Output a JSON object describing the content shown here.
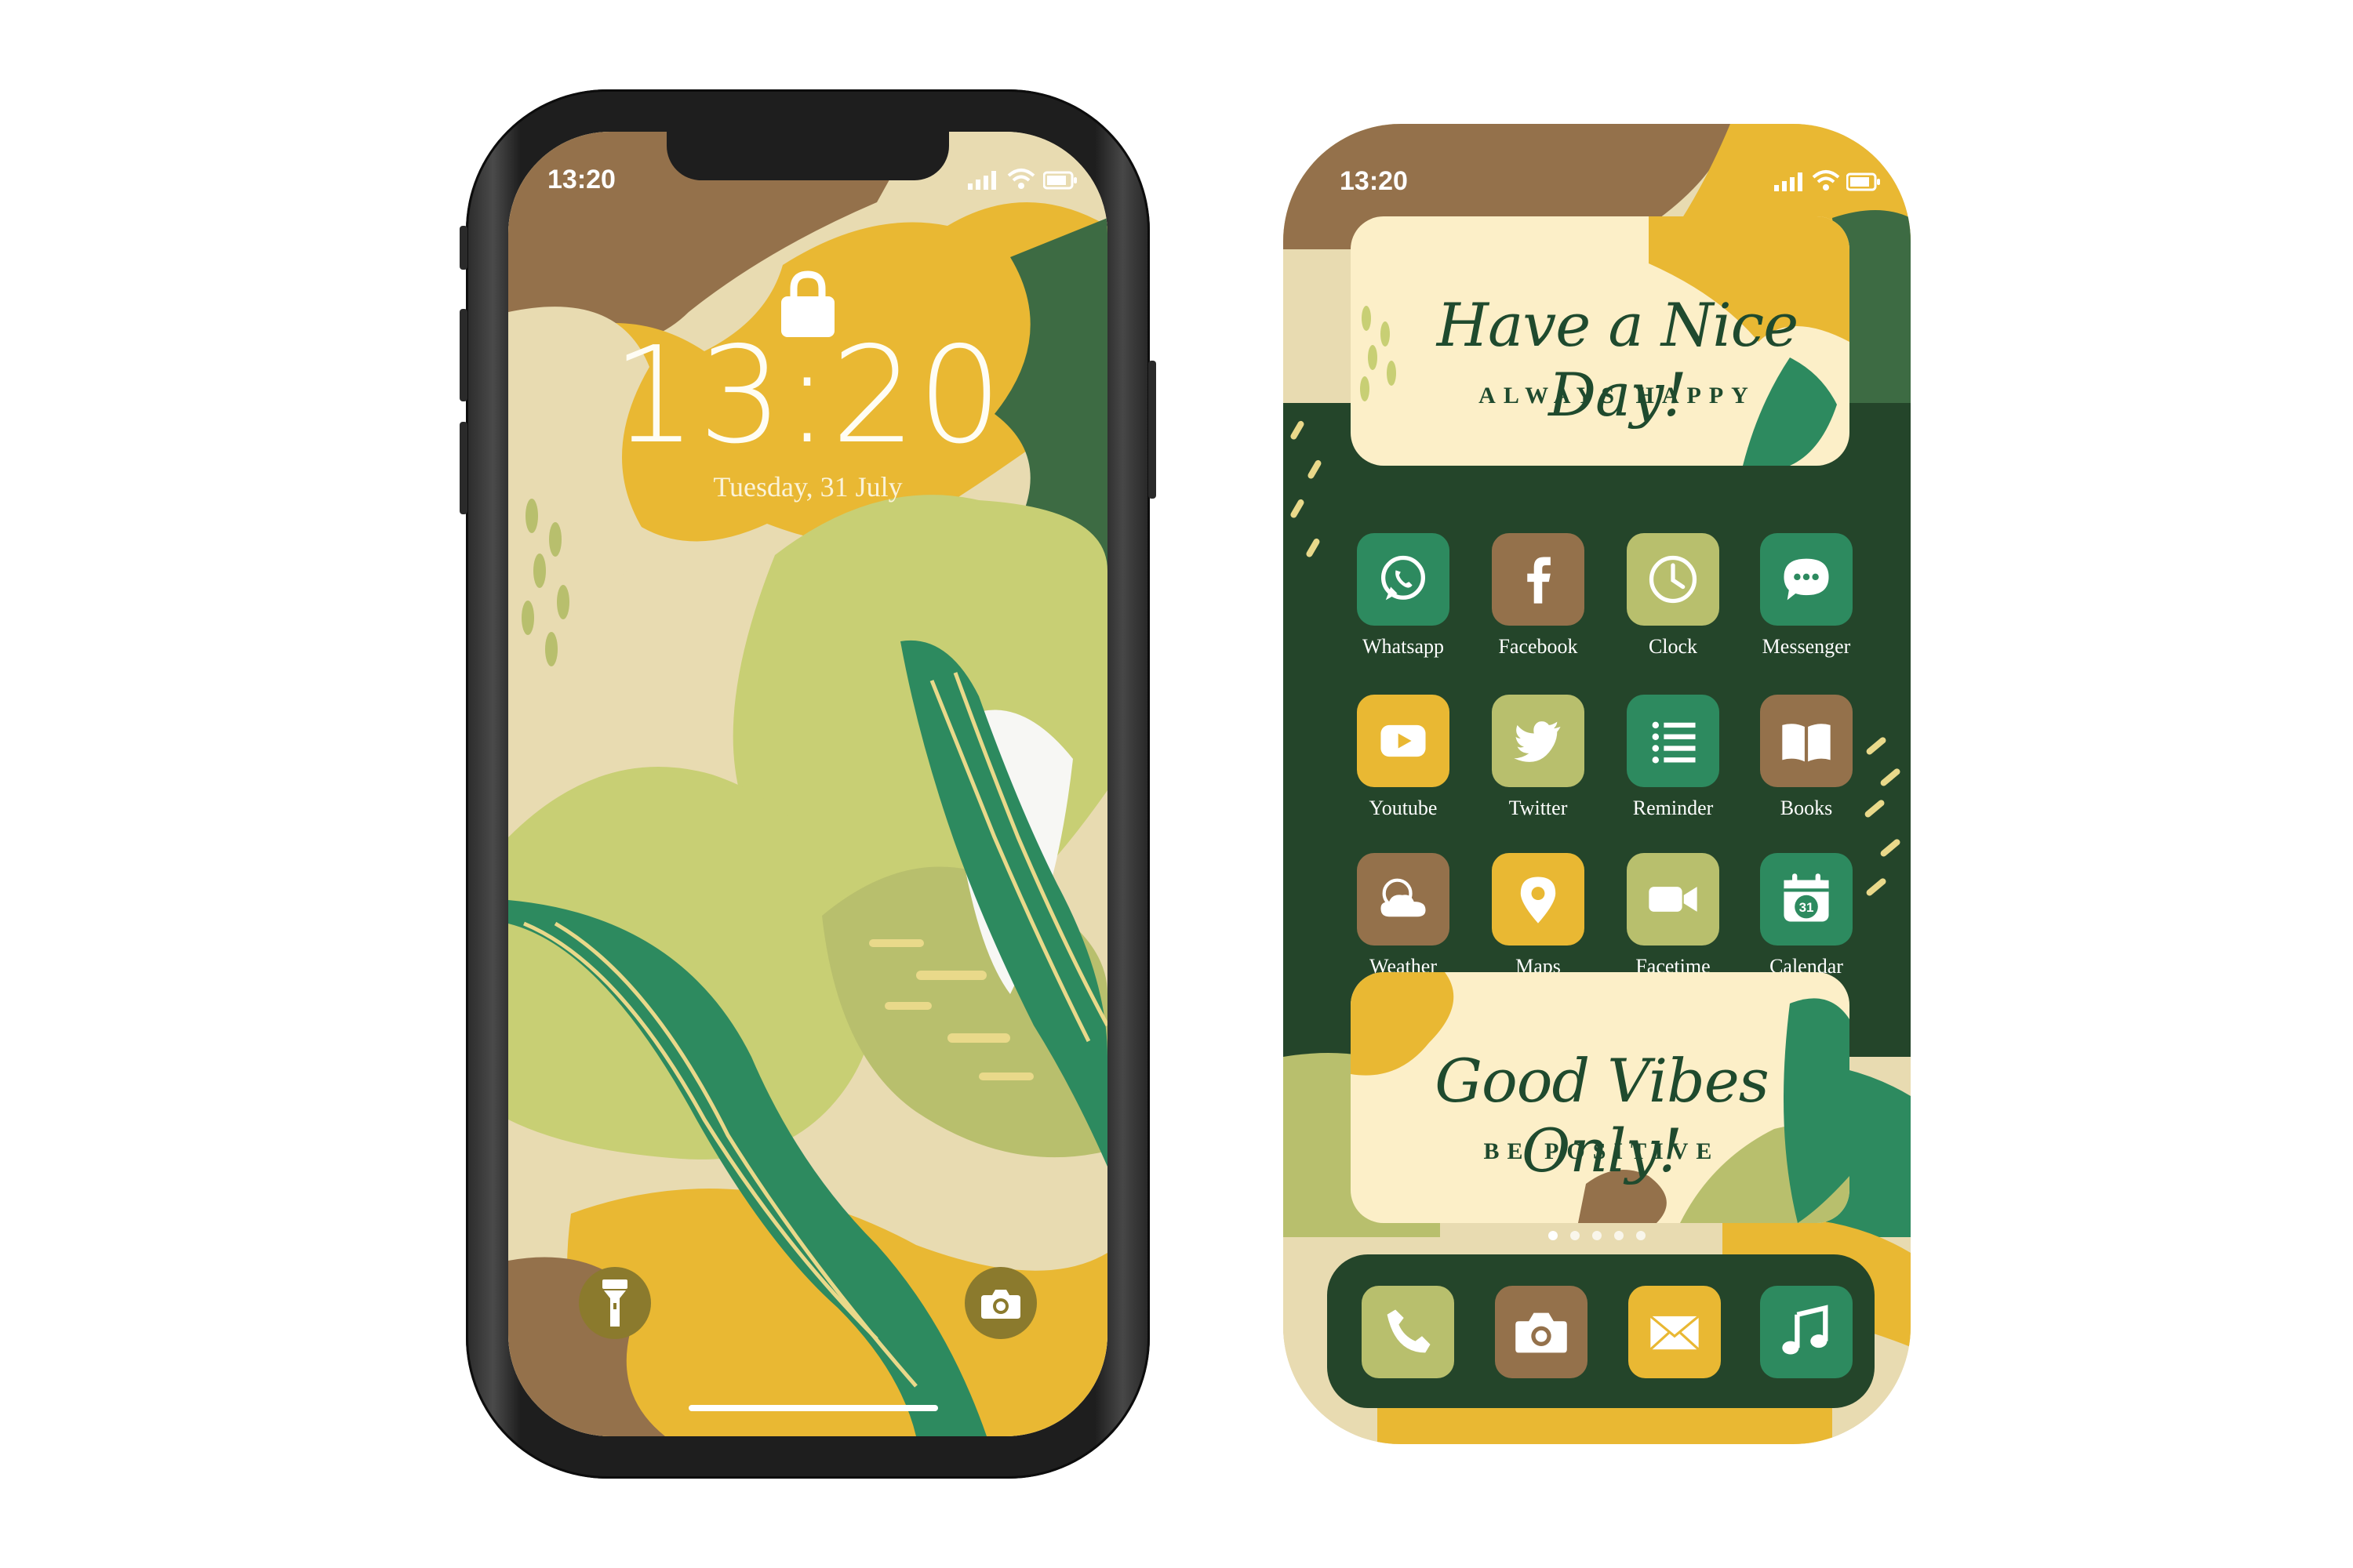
{
  "colors": {
    "brown": "#94714b",
    "mustard": "#e9b833",
    "dark_green": "#24452a",
    "forest_green": "#3d6b43",
    "teal_green": "#2d8a5f",
    "olive": "#b8bf6d",
    "lime": "#c8cf74",
    "sand": "#e8dbb1",
    "cream": "#fcefc8"
  },
  "lock_screen": {
    "status_time": "13:20",
    "clock": "13:20",
    "date": "Tuesday, 31 July",
    "icons": [
      "lock-icon",
      "signal-icon",
      "wifi-icon",
      "battery-icon",
      "flashlight-icon",
      "camera-icon"
    ]
  },
  "home_screen": {
    "status_time": "13:20",
    "widget_top": {
      "script": "Have a Nice Day!",
      "caption": "ALWAYS HAPPY"
    },
    "widget_bottom": {
      "script": "Good Vibes Only!",
      "caption": "BE POSITIVE"
    },
    "apps": [
      {
        "label": "Whatsapp",
        "icon": "whatsapp-icon",
        "color": "#2d8a5f"
      },
      {
        "label": "Facebook",
        "icon": "facebook-icon",
        "color": "#94714b"
      },
      {
        "label": "Clock",
        "icon": "clock-icon",
        "color": "#b8bf6d"
      },
      {
        "label": "Messenger",
        "icon": "messenger-icon",
        "color": "#2d8a5f"
      },
      {
        "label": "Youtube",
        "icon": "youtube-icon",
        "color": "#e9b833"
      },
      {
        "label": "Twitter",
        "icon": "twitter-icon",
        "color": "#b8bf6d"
      },
      {
        "label": "Reminder",
        "icon": "reminder-icon",
        "color": "#2d8a5f"
      },
      {
        "label": "Books",
        "icon": "books-icon",
        "color": "#94714b"
      },
      {
        "label": "Weather",
        "icon": "weather-icon",
        "color": "#94714b"
      },
      {
        "label": "Maps",
        "icon": "maps-icon",
        "color": "#e9b833"
      },
      {
        "label": "Facetime",
        "icon": "facetime-icon",
        "color": "#b8bf6d"
      },
      {
        "label": "Calendar",
        "icon": "calendar-icon",
        "color": "#2d8a5f",
        "badge": "31"
      }
    ],
    "page_indicator": {
      "pages": 5,
      "current": 1
    },
    "dock": [
      {
        "icon": "phone-icon",
        "color": "#b8bf6d"
      },
      {
        "icon": "camera-icon",
        "color": "#94714b"
      },
      {
        "icon": "mail-icon",
        "color": "#e9b833"
      },
      {
        "icon": "music-icon",
        "color": "#2d8a5f"
      }
    ]
  }
}
